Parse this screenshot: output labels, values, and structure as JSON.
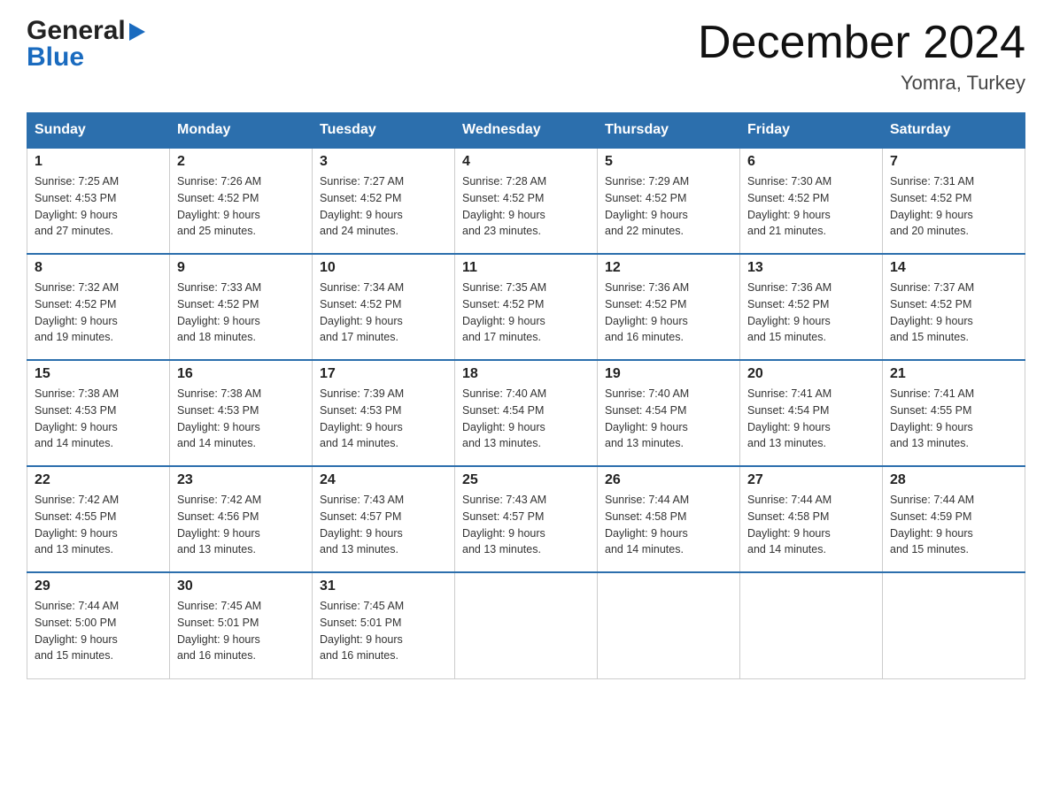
{
  "header": {
    "logo": {
      "general": "General",
      "blue": "Blue",
      "arrow": "▶"
    },
    "title": "December 2024",
    "location": "Yomra, Turkey"
  },
  "calendar": {
    "days_of_week": [
      "Sunday",
      "Monday",
      "Tuesday",
      "Wednesday",
      "Thursday",
      "Friday",
      "Saturday"
    ],
    "weeks": [
      [
        {
          "day": "1",
          "sunrise": "7:25 AM",
          "sunset": "4:53 PM",
          "daylight": "9 hours and 27 minutes."
        },
        {
          "day": "2",
          "sunrise": "7:26 AM",
          "sunset": "4:52 PM",
          "daylight": "9 hours and 25 minutes."
        },
        {
          "day": "3",
          "sunrise": "7:27 AM",
          "sunset": "4:52 PM",
          "daylight": "9 hours and 24 minutes."
        },
        {
          "day": "4",
          "sunrise": "7:28 AM",
          "sunset": "4:52 PM",
          "daylight": "9 hours and 23 minutes."
        },
        {
          "day": "5",
          "sunrise": "7:29 AM",
          "sunset": "4:52 PM",
          "daylight": "9 hours and 22 minutes."
        },
        {
          "day": "6",
          "sunrise": "7:30 AM",
          "sunset": "4:52 PM",
          "daylight": "9 hours and 21 minutes."
        },
        {
          "day": "7",
          "sunrise": "7:31 AM",
          "sunset": "4:52 PM",
          "daylight": "9 hours and 20 minutes."
        }
      ],
      [
        {
          "day": "8",
          "sunrise": "7:32 AM",
          "sunset": "4:52 PM",
          "daylight": "9 hours and 19 minutes."
        },
        {
          "day": "9",
          "sunrise": "7:33 AM",
          "sunset": "4:52 PM",
          "daylight": "9 hours and 18 minutes."
        },
        {
          "day": "10",
          "sunrise": "7:34 AM",
          "sunset": "4:52 PM",
          "daylight": "9 hours and 17 minutes."
        },
        {
          "day": "11",
          "sunrise": "7:35 AM",
          "sunset": "4:52 PM",
          "daylight": "9 hours and 17 minutes."
        },
        {
          "day": "12",
          "sunrise": "7:36 AM",
          "sunset": "4:52 PM",
          "daylight": "9 hours and 16 minutes."
        },
        {
          "day": "13",
          "sunrise": "7:36 AM",
          "sunset": "4:52 PM",
          "daylight": "9 hours and 15 minutes."
        },
        {
          "day": "14",
          "sunrise": "7:37 AM",
          "sunset": "4:52 PM",
          "daylight": "9 hours and 15 minutes."
        }
      ],
      [
        {
          "day": "15",
          "sunrise": "7:38 AM",
          "sunset": "4:53 PM",
          "daylight": "9 hours and 14 minutes."
        },
        {
          "day": "16",
          "sunrise": "7:38 AM",
          "sunset": "4:53 PM",
          "daylight": "9 hours and 14 minutes."
        },
        {
          "day": "17",
          "sunrise": "7:39 AM",
          "sunset": "4:53 PM",
          "daylight": "9 hours and 14 minutes."
        },
        {
          "day": "18",
          "sunrise": "7:40 AM",
          "sunset": "4:54 PM",
          "daylight": "9 hours and 13 minutes."
        },
        {
          "day": "19",
          "sunrise": "7:40 AM",
          "sunset": "4:54 PM",
          "daylight": "9 hours and 13 minutes."
        },
        {
          "day": "20",
          "sunrise": "7:41 AM",
          "sunset": "4:54 PM",
          "daylight": "9 hours and 13 minutes."
        },
        {
          "day": "21",
          "sunrise": "7:41 AM",
          "sunset": "4:55 PM",
          "daylight": "9 hours and 13 minutes."
        }
      ],
      [
        {
          "day": "22",
          "sunrise": "7:42 AM",
          "sunset": "4:55 PM",
          "daylight": "9 hours and 13 minutes."
        },
        {
          "day": "23",
          "sunrise": "7:42 AM",
          "sunset": "4:56 PM",
          "daylight": "9 hours and 13 minutes."
        },
        {
          "day": "24",
          "sunrise": "7:43 AM",
          "sunset": "4:57 PM",
          "daylight": "9 hours and 13 minutes."
        },
        {
          "day": "25",
          "sunrise": "7:43 AM",
          "sunset": "4:57 PM",
          "daylight": "9 hours and 13 minutes."
        },
        {
          "day": "26",
          "sunrise": "7:44 AM",
          "sunset": "4:58 PM",
          "daylight": "9 hours and 14 minutes."
        },
        {
          "day": "27",
          "sunrise": "7:44 AM",
          "sunset": "4:58 PM",
          "daylight": "9 hours and 14 minutes."
        },
        {
          "day": "28",
          "sunrise": "7:44 AM",
          "sunset": "4:59 PM",
          "daylight": "9 hours and 15 minutes."
        }
      ],
      [
        {
          "day": "29",
          "sunrise": "7:44 AM",
          "sunset": "5:00 PM",
          "daylight": "9 hours and 15 minutes."
        },
        {
          "day": "30",
          "sunrise": "7:45 AM",
          "sunset": "5:01 PM",
          "daylight": "9 hours and 16 minutes."
        },
        {
          "day": "31",
          "sunrise": "7:45 AM",
          "sunset": "5:01 PM",
          "daylight": "9 hours and 16 minutes."
        },
        null,
        null,
        null,
        null
      ]
    ],
    "labels": {
      "sunrise": "Sunrise:",
      "sunset": "Sunset:",
      "daylight": "Daylight:"
    }
  }
}
